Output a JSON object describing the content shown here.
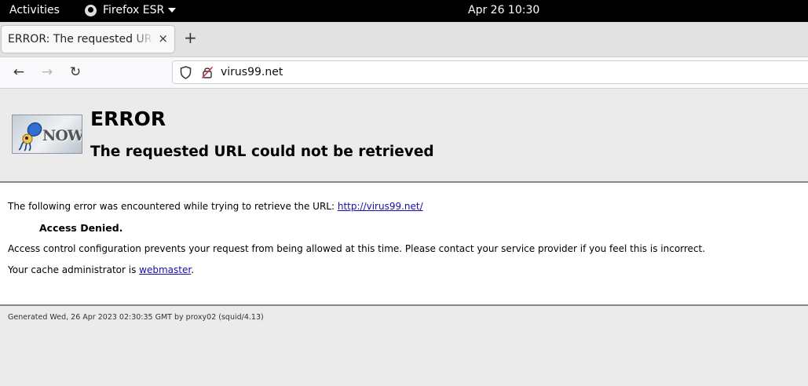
{
  "system_bar": {
    "activities": "Activities",
    "app_name": "Firefox ESR",
    "clock": "Apr 26  10:30"
  },
  "tabs": [
    {
      "title": "ERROR: The requested URL could not be retrieved",
      "close": "×"
    }
  ],
  "new_tab": "+",
  "navigation": {
    "back": "←",
    "forward": "→",
    "reload": "↻",
    "url": "virus99.net"
  },
  "icons": {
    "shield": "shield-icon",
    "insecure": "insecure-lock-icon",
    "logo": "squid-now-logo"
  },
  "page": {
    "logo_text": "NOW",
    "title": "ERROR",
    "subtitle": "The requested URL could not be retrieved",
    "intro": "The following error was encountered while trying to retrieve the URL: ",
    "intro_link": "http://virus99.net/",
    "denied": "Access Denied.",
    "explanation": "Access control configuration prevents your request from being allowed at this time. Please contact your service provider if you feel this is incorrect.",
    "admin_prefix": "Your cache administrator is ",
    "admin_link": "webmaster",
    "admin_suffix": ".",
    "footer": "Generated Wed, 26 Apr 2023 02:30:35 GMT by proxy02 (squid/4.13)"
  },
  "colors": {
    "link": "#1a0dab",
    "topbar": "#000000"
  }
}
